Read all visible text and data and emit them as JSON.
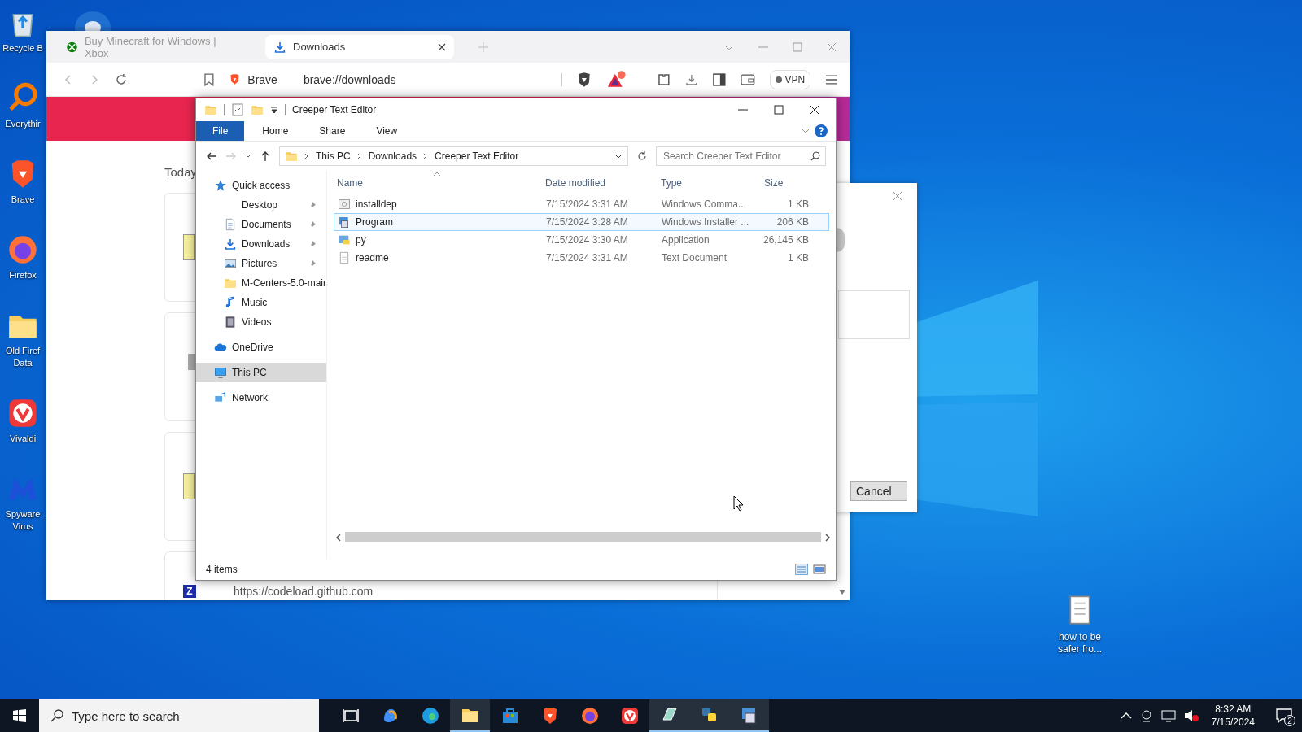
{
  "desktop_icons": [
    {
      "kind": "recycle",
      "lines": [
        "Recycle B"
      ]
    },
    {
      "kind": "magnifier",
      "lines": [
        "Everythir"
      ]
    },
    {
      "kind": "lion",
      "lines": [
        "Brave"
      ]
    },
    {
      "kind": "fox",
      "lines": [
        "Firefox"
      ]
    },
    {
      "kind": "folder",
      "lines": [
        "Old Firef",
        "Data"
      ]
    },
    {
      "kind": "v",
      "lines": [
        "Vivaldi"
      ]
    },
    {
      "kind": "m",
      "lines": [
        "Spyware",
        "Virus"
      ]
    }
  ],
  "desktop_file": {
    "lines": [
      "how to be",
      "safer fro..."
    ]
  },
  "browser": {
    "tabs": [
      {
        "title": "Buy Minecraft for Windows | Xbox",
        "kind": "xbox",
        "selected": false
      },
      {
        "title": "Downloads",
        "kind": "download",
        "selected": true
      }
    ],
    "address": {
      "site": "Brave",
      "url": "brave://downloads"
    },
    "vpn": "VPN",
    "page": {
      "heading": "Today",
      "archive_badge": "Z",
      "source_url": "https://codeload.github.com"
    }
  },
  "dialog": {
    "button": "Cancel"
  },
  "explorer": {
    "title": "Creeper Text Editor",
    "ribbon_tabs": [
      {
        "label": "File",
        "kind": "file"
      },
      {
        "label": "Home",
        "kind": "tab"
      },
      {
        "label": "Share",
        "kind": "tab"
      },
      {
        "label": "View",
        "kind": "tab"
      }
    ],
    "breadcrumb": [
      "This PC",
      "Downloads",
      "Creeper Text Editor"
    ],
    "search": {
      "placeholder": "Search Creeper Text Editor"
    },
    "nav": [
      {
        "label": "Quick access",
        "kind": "star",
        "selected": false,
        "children": [
          {
            "label": "Desktop",
            "kind": "blank",
            "pinned": true
          },
          {
            "label": "Documents",
            "kind": "doc",
            "pinned": true
          },
          {
            "label": "Downloads",
            "kind": "download",
            "pinned": true
          },
          {
            "label": "Pictures",
            "kind": "picture",
            "pinned": true
          },
          {
            "label": "M-Centers-5.0-mair",
            "kind": "folder",
            "pinned": false
          },
          {
            "label": "Music",
            "kind": "music",
            "pinned": false
          },
          {
            "label": "Videos",
            "kind": "video",
            "pinned": false
          }
        ]
      },
      {
        "label": "OneDrive",
        "kind": "cloud",
        "selected": false
      },
      {
        "label": "This PC",
        "kind": "pc",
        "selected": true
      },
      {
        "label": "Network",
        "kind": "network",
        "selected": false
      }
    ],
    "columns": [
      "Name",
      "Date modified",
      "Type",
      "Size"
    ],
    "rows": [
      {
        "kind": "cmd",
        "name": "installdep",
        "date": "7/15/2024 3:31 AM",
        "type": "Windows Comma...",
        "size": "1 KB",
        "selected": false
      },
      {
        "kind": "installer",
        "name": "Program",
        "date": "7/15/2024 3:28 AM",
        "type": "Windows Installer ...",
        "size": "206 KB",
        "selected": true
      },
      {
        "kind": "app",
        "name": "py",
        "date": "7/15/2024 3:30 AM",
        "type": "Application",
        "size": "26,145 KB",
        "selected": false
      },
      {
        "kind": "text",
        "name": "readme",
        "date": "7/15/2024 3:31 AM",
        "type": "Text Document",
        "size": "1 KB",
        "selected": false
      }
    ],
    "status": "4 items"
  },
  "taskbar": {
    "search_placeholder": "Type here to search",
    "apps": [
      {
        "kind": "taskview",
        "running": false
      },
      {
        "kind": "swirl",
        "running": false
      },
      {
        "kind": "edge",
        "running": false
      },
      {
        "kind": "folder",
        "running": true
      },
      {
        "kind": "store",
        "running": false
      },
      {
        "kind": "lion",
        "running": false
      },
      {
        "kind": "fox",
        "running": false
      },
      {
        "kind": "v",
        "running": false
      },
      {
        "kind": "notebook",
        "running": true
      },
      {
        "kind": "python",
        "running": true
      },
      {
        "kind": "installer",
        "running": true
      }
    ],
    "time": "8:32 AM",
    "date": "7/15/2024",
    "notifications": "2"
  }
}
